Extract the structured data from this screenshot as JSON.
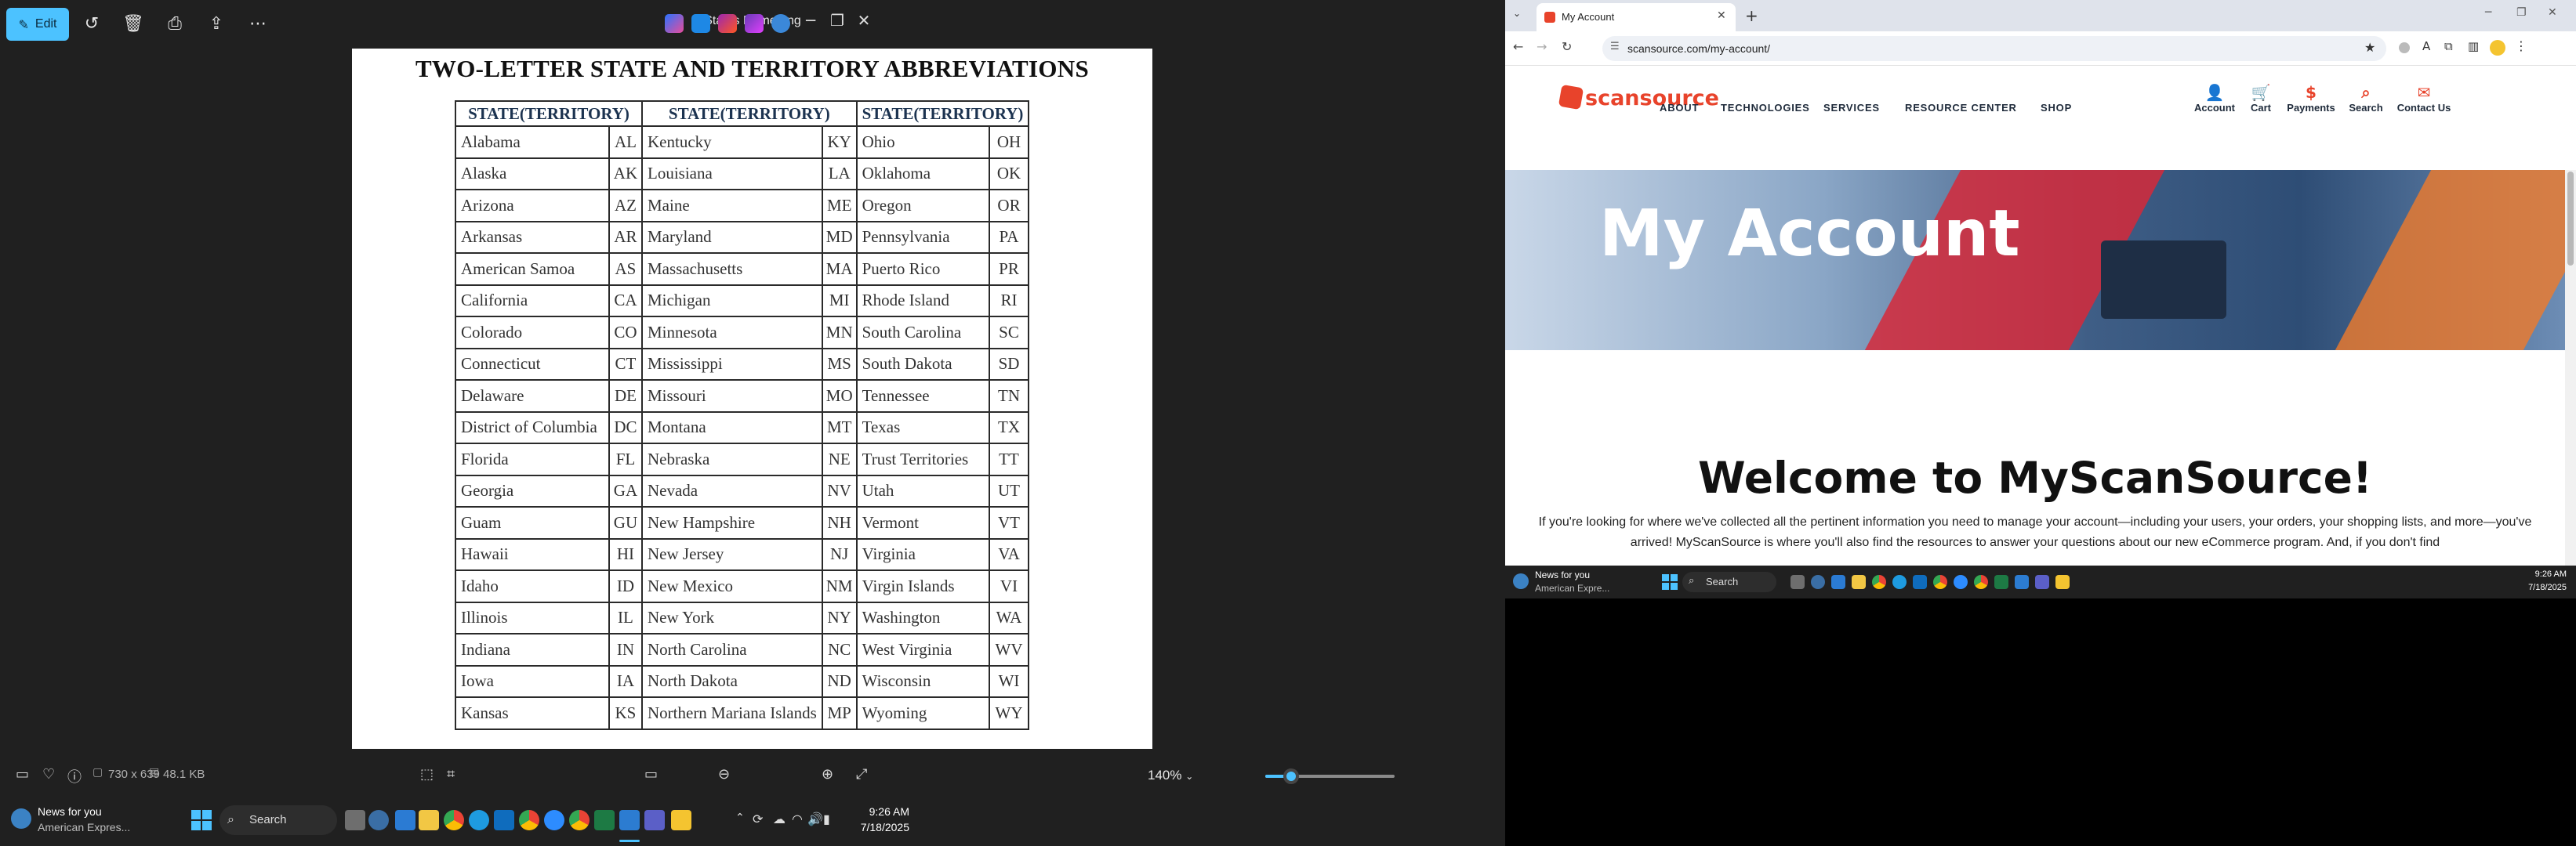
{
  "photos": {
    "edit_label": "Edit",
    "filename": "States Name.png",
    "image_dims": "730 x 639",
    "file_size": "48.1 KB",
    "zoom": "140%",
    "zoom_fraction": 0.2
  },
  "doc": {
    "title": "TWO-LETTER STATE AND TERRITORY ABBREVIATIONS",
    "headers": [
      "STATE(TERRITORY)",
      "STATE(TERRITORY)",
      "STATE(TERRITORY)"
    ],
    "rows": [
      [
        "Alabama",
        "AL",
        "Kentucky",
        "KY",
        "Ohio",
        "OH"
      ],
      [
        "Alaska",
        "AK",
        "Louisiana",
        "LA",
        "Oklahoma",
        "OK"
      ],
      [
        "Arizona",
        "AZ",
        "Maine",
        "ME",
        "Oregon",
        "OR"
      ],
      [
        "Arkansas",
        "AR",
        "Maryland",
        "MD",
        "Pennsylvania",
        "PA"
      ],
      [
        "American Samoa",
        "AS",
        "Massachusetts",
        "MA",
        "Puerto Rico",
        "PR"
      ],
      [
        "California",
        "CA",
        "Michigan",
        "MI",
        "Rhode Island",
        "RI"
      ],
      [
        "Colorado",
        "CO",
        "Minnesota",
        "MN",
        "South Carolina",
        "SC"
      ],
      [
        "Connecticut",
        "CT",
        "Mississippi",
        "MS",
        "South Dakota",
        "SD"
      ],
      [
        "Delaware",
        "DE",
        "Missouri",
        "MO",
        "Tennessee",
        "TN"
      ],
      [
        "District of Columbia",
        "DC",
        "Montana",
        "MT",
        "Texas",
        "TX"
      ],
      [
        "Florida",
        "FL",
        "Nebraska",
        "NE",
        "Trust Territories",
        "TT"
      ],
      [
        "Georgia",
        "GA",
        "Nevada",
        "NV",
        "Utah",
        "UT"
      ],
      [
        "Guam",
        "GU",
        "New Hampshire",
        "NH",
        "Vermont",
        "VT"
      ],
      [
        "Hawaii",
        "HI",
        "New Jersey",
        "NJ",
        "Virginia",
        "VA"
      ],
      [
        "Idaho",
        "ID",
        "New Mexico",
        "NM",
        "Virgin Islands",
        "VI"
      ],
      [
        "Illinois",
        "IL",
        "New York",
        "NY",
        "Washington",
        "WA"
      ],
      [
        "Indiana",
        "IN",
        "North Carolina",
        "NC",
        "West Virginia",
        "WV"
      ],
      [
        "Iowa",
        "IA",
        "North Dakota",
        "ND",
        "Wisconsin",
        "WI"
      ],
      [
        "Kansas",
        "KS",
        "Northern Mariana Islands",
        "MP",
        "Wyoming",
        "WY"
      ]
    ]
  },
  "taskbar": {
    "news_title": "News for you",
    "news_sub": "American Expres...",
    "search": "Search",
    "time": "9:26 AM",
    "date": "7/18/2025"
  },
  "browser": {
    "tab_title": "My Account",
    "url": "scansource.com/my-account/"
  },
  "site": {
    "logo": "scansource",
    "nav": [
      "ABOUT",
      "TECHNOLOGIES",
      "SERVICES",
      "RESOURCE CENTER",
      "SHOP"
    ],
    "nav_icons": [
      "Account",
      "Cart",
      "Payments",
      "Search",
      "Contact Us"
    ],
    "hero_title": "My Account",
    "welcome": "Welcome to MyScanSource!",
    "paragraph": "If you're looking for where we've collected all the pertinent information you need to manage your account—including your users, your orders, your shopping lists, and more—you've arrived! MyScanSource is where you'll also find the resources to answer your questions about our new eCommerce program. And, if you don't find"
  },
  "taskbar2": {
    "news_title": "News for you",
    "news_sub": "American Expre...",
    "search": "Search",
    "time": "9:26 AM",
    "date": "7/18/2025"
  },
  "colors": {
    "accent": "#4cc2ff",
    "brand": "#e8432b"
  }
}
